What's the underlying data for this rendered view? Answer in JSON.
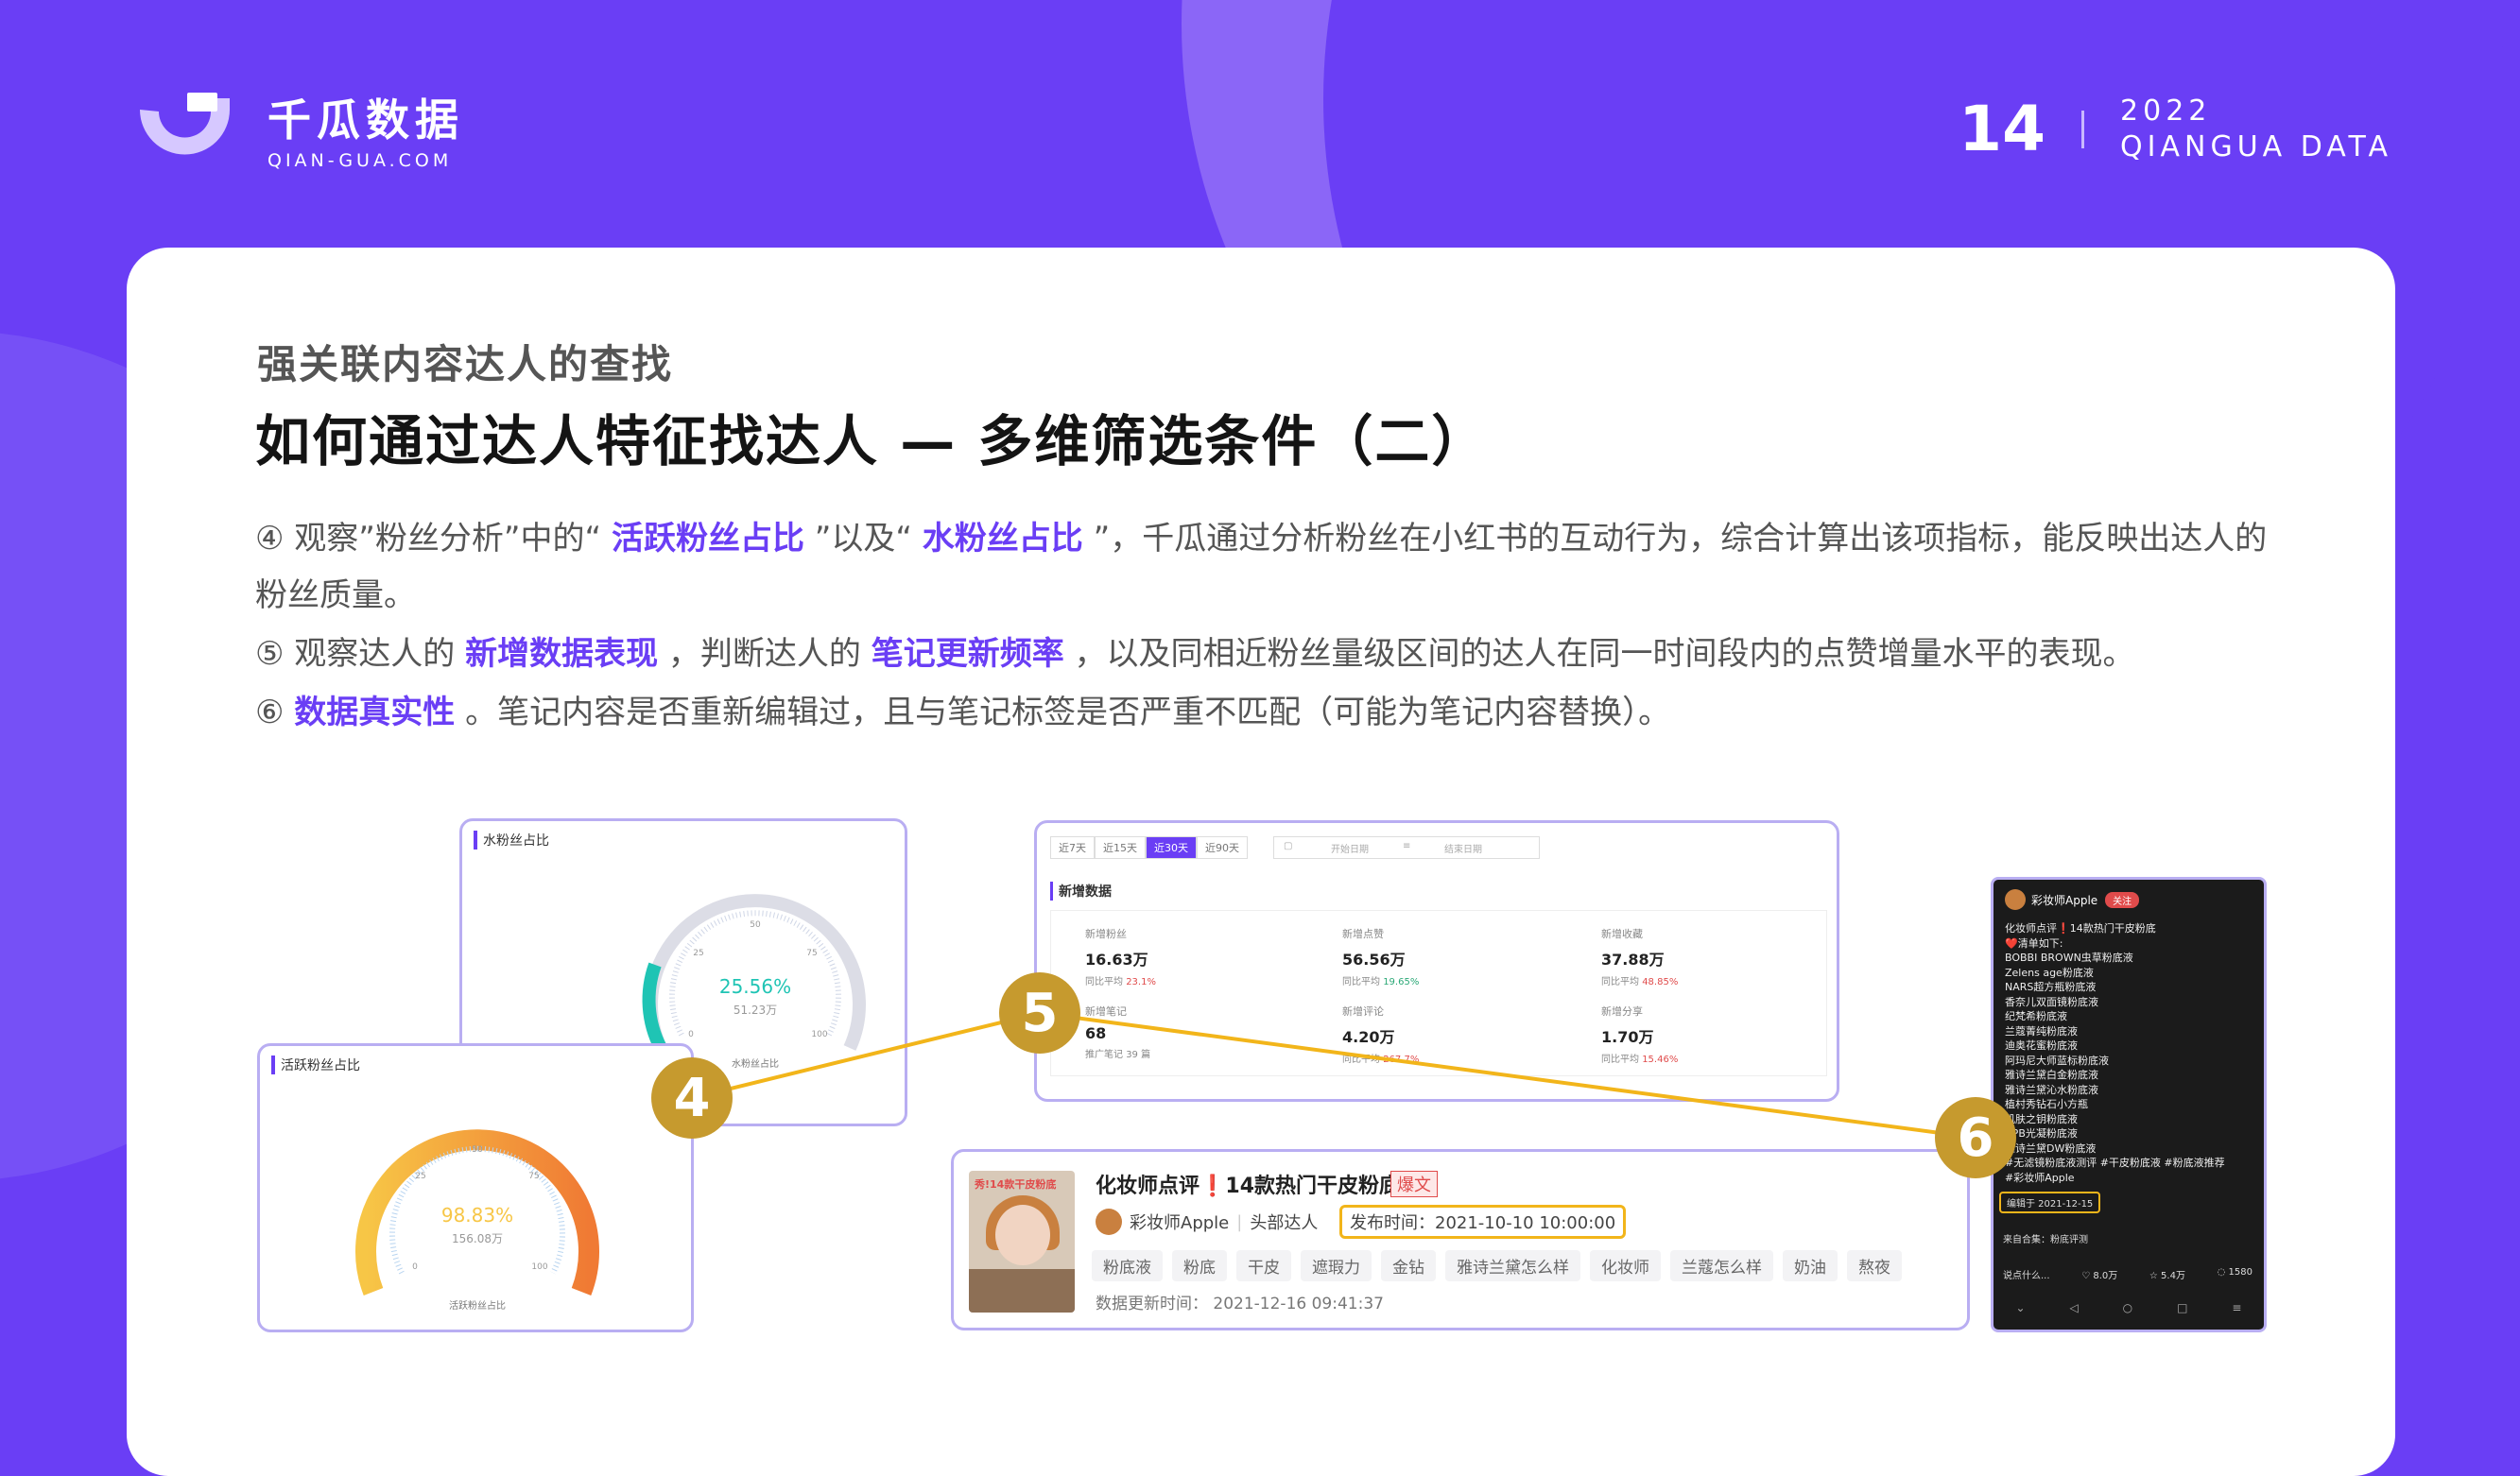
{
  "brand": {
    "name_cn": "千瓜数据",
    "name_en": "QIAN-GUA.COM"
  },
  "header": {
    "page_number": "14",
    "year": "2022",
    "org": "QIANGUA DATA"
  },
  "subtitle": "强关联内容达人的查找",
  "title": "如何通过达人特征找达人 — 多维筛选条件（二）",
  "points": {
    "p4_a": "④ 观察”粉丝分析”中的“ ",
    "p4_h1": "活跃粉丝占比",
    "p4_b": " ”以及“ ",
    "p4_h2": "水粉丝占比",
    "p4_c": " ”，千瓜通过分析粉丝在小红书的互动行为，综合计算出该项指标，能反映出达人的粉丝质量。",
    "p5_a": "⑤ 观察达人的 ",
    "p5_h1": "新增数据表现",
    "p5_b": " ，判断达人的 ",
    "p5_h2": "笔记更新频率",
    "p5_c": " ，以及同相近粉丝量级区间的达人在同一时间段内的点赞增量水平的表现。",
    "p6_a": "⑥ ",
    "p6_h1": "数据真实性",
    "p6_b": " 。笔记内容是否重新编辑过，且与笔记标签是否严重不匹配（可能为笔记内容替换）。"
  },
  "water_fans": {
    "title": "水粉丝占比",
    "percent": 25.56,
    "percent_label": "25.56%",
    "count": "51.23万",
    "scale": {
      "min": "0",
      "q1": "25",
      "mid": "50",
      "q3": "75",
      "max": "100"
    },
    "bottom_label": "水粉丝占比"
  },
  "active_fans": {
    "title": "活跃粉丝占比",
    "percent": 98.83,
    "percent_label": "98.83%",
    "count": "156.08万",
    "scale": {
      "min": "0",
      "q1": "25",
      "mid": "50",
      "q3": "75",
      "max": "100"
    },
    "bottom_label": "活跃粉丝占比"
  },
  "new_data": {
    "tabs": [
      "近7天",
      "近15天",
      "近30天",
      "近90天"
    ],
    "active_tab": "近30天",
    "date_placeholder_start": "开始日期",
    "date_placeholder_end": "结束日期",
    "section_title": "新增数据",
    "stats": [
      {
        "label": "新增粉丝",
        "value": "16.63万",
        "compare": "同比平均",
        "delta": "23.1%",
        "dir": "up"
      },
      {
        "label": "新增点赞",
        "value": "56.56万",
        "compare": "同比平均",
        "delta": "19.65%",
        "dir": "down"
      },
      {
        "label": "新增收藏",
        "value": "37.88万",
        "compare": "同比平均",
        "delta": "48.85%",
        "dir": "up"
      },
      {
        "label": "新增笔记",
        "value": "68",
        "compare": "推广笔记",
        "delta": "39 篇",
        "dir": "none"
      },
      {
        "label": "新增评论",
        "value": "4.20万",
        "compare": "同比平均",
        "delta": "267.7%",
        "dir": "up"
      },
      {
        "label": "新增分享",
        "value": "1.70万",
        "compare": "同比平均",
        "delta": "15.46%",
        "dir": "up"
      }
    ]
  },
  "note": {
    "thumb_caption": "秀!14款干皮粉底",
    "title": "化妆师点评❗14款热门干皮粉底",
    "hot_tag": "爆文",
    "author": "彩妆师Apple",
    "author_type": "头部达人",
    "publish_time": "发布时间：2021-10-10 10:00:00",
    "tags": [
      "粉底液",
      "粉底",
      "干皮",
      "遮瑕力",
      "金钻",
      "雅诗兰黛怎么样",
      "化妆师",
      "兰蔻怎么样",
      "奶油",
      "熬夜"
    ],
    "updated": "数据更新时间：  2021-12-16 09:41:37"
  },
  "phone": {
    "user": "彩妆师Apple",
    "follow": "关注",
    "lines": [
      "化妆师点评❗14款热门干皮粉底",
      "❤️清单如下:",
      "BOBBI BROWN虫草粉底液",
      "Zelens age粉底液",
      "NARS超方瓶粉底液",
      "香奈儿双面镜粉底液",
      "纪梵希粉底液",
      "兰蔻菁纯粉底液",
      "迪奥花蜜粉底液",
      "阿玛尼大师蓝标粉底液",
      "雅诗兰黛白金粉底液",
      "雅诗兰黛沁水粉底液",
      "植村秀钻石小方瓶",
      "肌肤之钥粉底液",
      "CPB光凝粉底液",
      "雅诗兰黛DW粉底液",
      "#无滤镜粉底液测评 #干皮粉底液 #粉底液推荐",
      "#彩妆师Apple"
    ],
    "edit_date": "编辑于 2021-12-15",
    "collection": "来自合集：粉底评测",
    "likes": "8.0万",
    "stars": "5.4万",
    "comments": "1580",
    "comment_hint": "说点什么..."
  },
  "badges": {
    "b4": "4",
    "b5": "5",
    "b6": "6"
  },
  "colors": {
    "brand": "#6a3ef5",
    "highlight": "#6a3ef5",
    "badge": "#c69a2e",
    "connector": "#f2b51a",
    "panel_border": "#b9aef2"
  }
}
